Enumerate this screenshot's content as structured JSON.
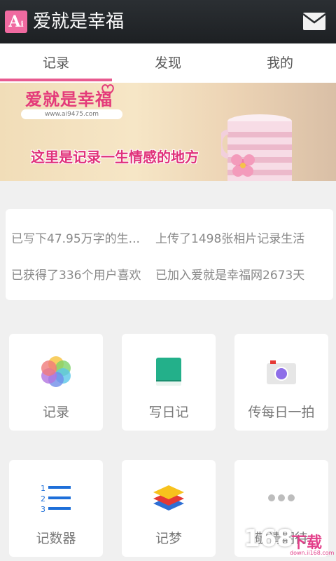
{
  "app": {
    "title": "爱就是幸福",
    "logo_letter": "A",
    "logo_sub": "i"
  },
  "tabs": [
    {
      "label": "记录",
      "active": true
    },
    {
      "label": "发现",
      "active": false
    },
    {
      "label": "我的",
      "active": false
    }
  ],
  "banner": {
    "logo_text": "爱就是幸福",
    "url": "www.ai9475.com",
    "slogan": "这里是记录一生情感的地方"
  },
  "stats": {
    "words": "已写下47.95万字的生...",
    "photos": "上传了1498张相片记录生活",
    "likes": "已获得了336个用户喜欢",
    "days": "已加入爱就是幸福网2673天"
  },
  "tiles": [
    {
      "label": "记录",
      "icon": "photos-flower-icon"
    },
    {
      "label": "写日记",
      "icon": "diary-book-icon"
    },
    {
      "label": "传每日一拍",
      "icon": "camera-icon"
    },
    {
      "label": "记数器",
      "icon": "numbered-list-icon"
    },
    {
      "label": "记梦",
      "icon": "layers-icon"
    },
    {
      "label": "敬请期待",
      "icon": "more-dots-icon"
    }
  ],
  "watermark": {
    "big": "168",
    "text": "下载",
    "url": "down.ii168.com"
  },
  "colors": {
    "accent": "#e85a90",
    "titlebar": "#1f2225",
    "background": "#f0f0f0"
  }
}
